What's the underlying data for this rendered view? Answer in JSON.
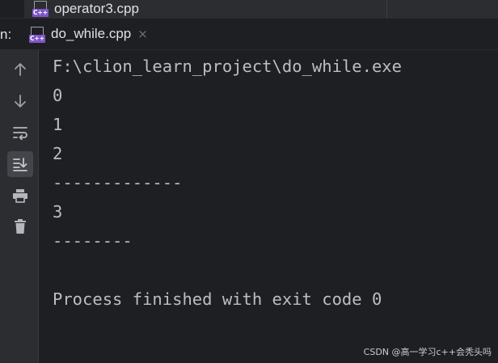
{
  "header": {
    "file_above": "operator3.cpp",
    "tab_prefix": "n:",
    "active_tab": "do_while.cpp",
    "tab_close_glyph": "×",
    "file_icon_badge": "C++"
  },
  "toolbar": {
    "tools": [
      {
        "name": "up-arrow-icon",
        "active": false
      },
      {
        "name": "down-arrow-icon",
        "active": false
      },
      {
        "name": "soft-wrap-icon",
        "active": false
      },
      {
        "name": "scroll-to-end-icon",
        "active": true
      },
      {
        "name": "print-icon",
        "active": false
      },
      {
        "name": "trash-icon",
        "active": false
      }
    ]
  },
  "console": {
    "lines": [
      "F:\\clion_learn_project\\do_while.exe",
      "0",
      "1",
      "2",
      "-------------",
      "3",
      "--------",
      "",
      "Process finished with exit code 0"
    ]
  },
  "watermark": "CSDN @高一学习c++会秃头吗",
  "colors": {
    "background": "#1e1f22",
    "toolbar": "#2b2d30",
    "text": "#bcbec4",
    "icon": "#9da0a6",
    "cpp_badge": "#7f56c7"
  }
}
